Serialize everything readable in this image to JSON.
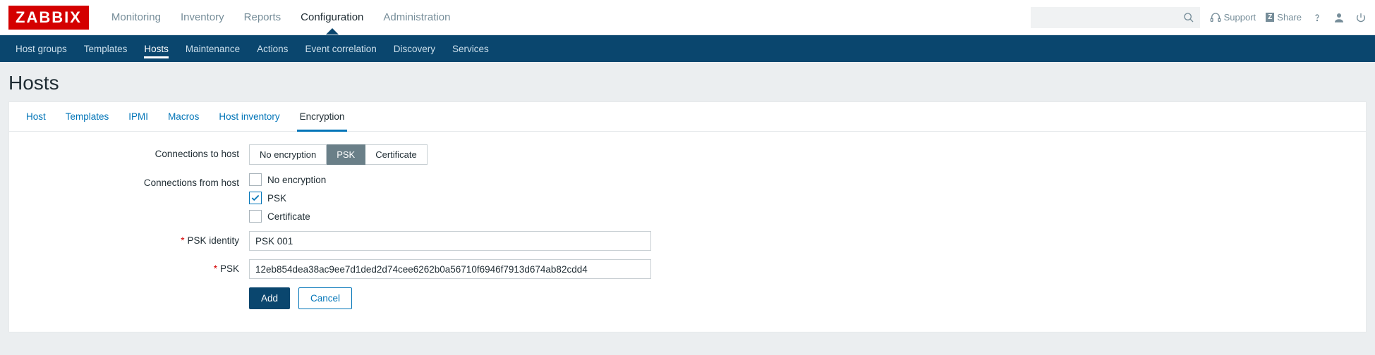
{
  "logo": "ZABBIX",
  "mainNav": {
    "items": [
      {
        "label": "Monitoring"
      },
      {
        "label": "Inventory"
      },
      {
        "label": "Reports"
      },
      {
        "label": "Configuration"
      },
      {
        "label": "Administration"
      }
    ],
    "activeIndex": 3
  },
  "topRight": {
    "search_placeholder": "",
    "support_label": "Support",
    "share_label": "Share"
  },
  "subNav": {
    "items": [
      {
        "label": "Host groups"
      },
      {
        "label": "Templates"
      },
      {
        "label": "Hosts"
      },
      {
        "label": "Maintenance"
      },
      {
        "label": "Actions"
      },
      {
        "label": "Event correlation"
      },
      {
        "label": "Discovery"
      },
      {
        "label": "Services"
      }
    ],
    "activeIndex": 2
  },
  "pageTitle": "Hosts",
  "tabs": {
    "items": [
      {
        "label": "Host"
      },
      {
        "label": "Templates"
      },
      {
        "label": "IPMI"
      },
      {
        "label": "Macros"
      },
      {
        "label": "Host inventory"
      },
      {
        "label": "Encryption"
      }
    ],
    "activeIndex": 5
  },
  "form": {
    "connections_to_host_label": "Connections to host",
    "conn_to_options": {
      "no_encryption": "No encryption",
      "psk": "PSK",
      "certificate": "Certificate"
    },
    "connections_from_host_label": "Connections from host",
    "from_no_encryption": "No encryption",
    "from_psk": "PSK",
    "from_certificate": "Certificate",
    "psk_identity_label": "PSK identity",
    "psk_identity_value": "PSK 001",
    "psk_label": "PSK",
    "psk_value": "12eb854dea38ac9ee7d1ded2d74cee6262b0a56710f6946f7913d674ab82cdd4",
    "add_label": "Add",
    "cancel_label": "Cancel"
  }
}
